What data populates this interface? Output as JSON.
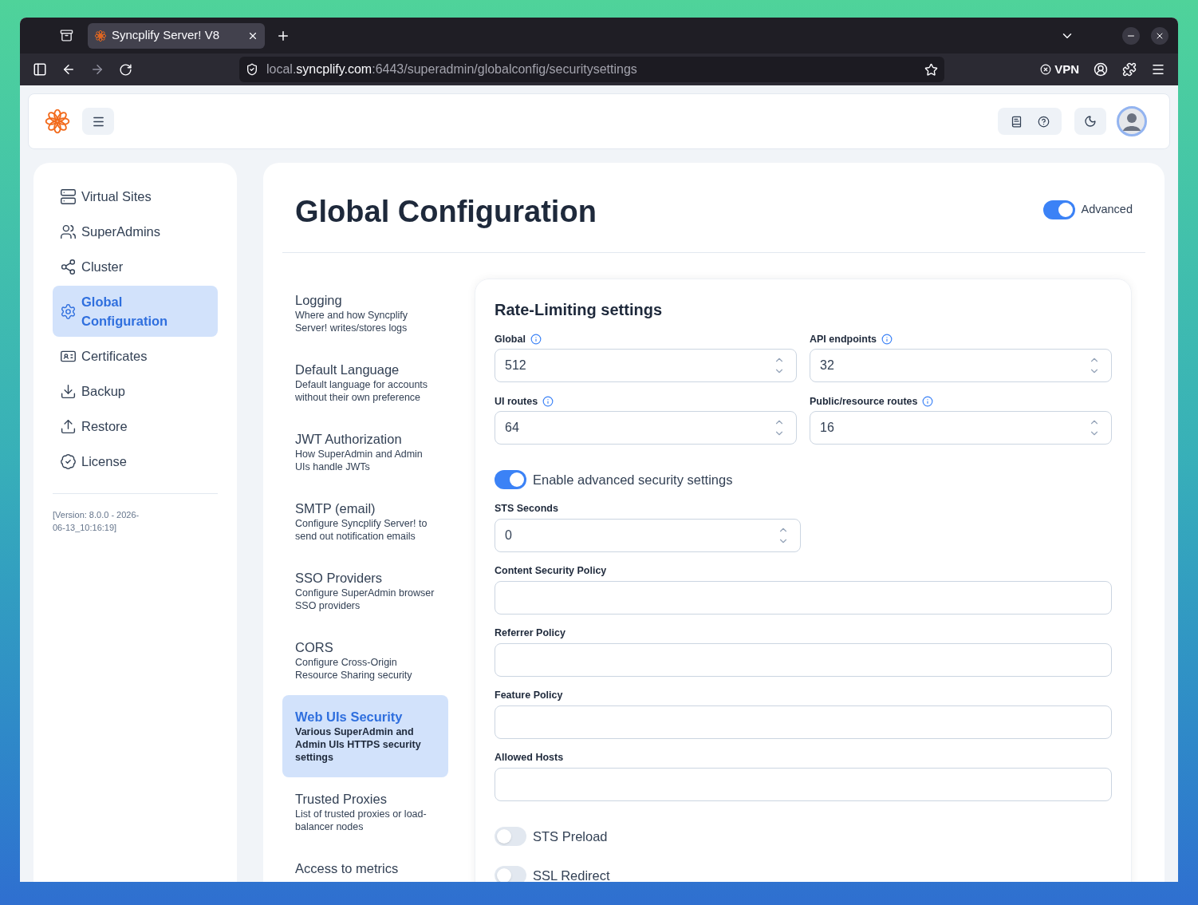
{
  "browser": {
    "tab": {
      "title": "Syncplify Server! V8",
      "selected": true
    },
    "url": {
      "prefix": "local.",
      "host": "syncplify.com",
      "path": ":6443/superadmin/globalconfig/securitysettings"
    },
    "vpn": "VPN"
  },
  "sidebar": {
    "items": [
      {
        "label": "Virtual Sites",
        "selected": false
      },
      {
        "label": "SuperAdmins",
        "selected": false
      },
      {
        "label": "Cluster",
        "selected": false
      },
      {
        "label": "Global Configuration",
        "selected": true
      },
      {
        "label": "Certificates",
        "selected": false
      },
      {
        "label": "Backup",
        "selected": false
      },
      {
        "label": "Restore",
        "selected": false
      },
      {
        "label": "License",
        "selected": false
      }
    ],
    "version": "[Version: 8.0.0 - 2026-06-13_10:16:19]"
  },
  "page": {
    "title": "Global Configuration",
    "advanced": {
      "label": "Advanced",
      "on": true
    }
  },
  "sections": [
    {
      "title": "Logging",
      "description": "Where and how Syncplify Server! writes/stores logs",
      "selected": false
    },
    {
      "title": "Default Language",
      "description": "Default language for accounts without their own preference",
      "selected": false
    },
    {
      "title": "JWT Authorization",
      "description": "How SuperAdmin and Admin UIs handle JWTs",
      "selected": false
    },
    {
      "title": "SMTP (email)",
      "description": "Configure Syncplify Server! to send out notification emails",
      "selected": false
    },
    {
      "title": "SSO Providers",
      "description": "Configure SuperAdmin browser SSO providers",
      "selected": false
    },
    {
      "title": "CORS",
      "description": "Configure Cross-Origin Resource Sharing security",
      "selected": false
    },
    {
      "title": "Web UIs Security",
      "description": "Various SuperAdmin and Admin UIs HTTPS security settings",
      "selected": true
    },
    {
      "title": "Trusted Proxies",
      "description": "List of trusted proxies or load-balancer nodes",
      "selected": false
    },
    {
      "title": "Access to metrics",
      "selected": false
    }
  ],
  "form": {
    "title": "Rate-Limiting settings",
    "rate_fields": [
      {
        "label": "Global",
        "value": "512"
      },
      {
        "label": "API endpoints",
        "value": "32"
      },
      {
        "label": "UI routes",
        "value": "64"
      },
      {
        "label": "Public/resource routes",
        "value": "16"
      }
    ],
    "advanced_toggle": {
      "label": "Enable advanced security settings",
      "on": true
    },
    "sts_seconds": {
      "label": "STS Seconds",
      "value": "0"
    },
    "text_fields": [
      {
        "label": "Content Security Policy"
      },
      {
        "label": "Referrer Policy"
      },
      {
        "label": "Feature Policy"
      },
      {
        "label": "Allowed Hosts"
      }
    ],
    "switches": [
      {
        "label": "STS Preload",
        "on": false
      },
      {
        "label": "SSL Redirect",
        "on": false
      }
    ]
  }
}
